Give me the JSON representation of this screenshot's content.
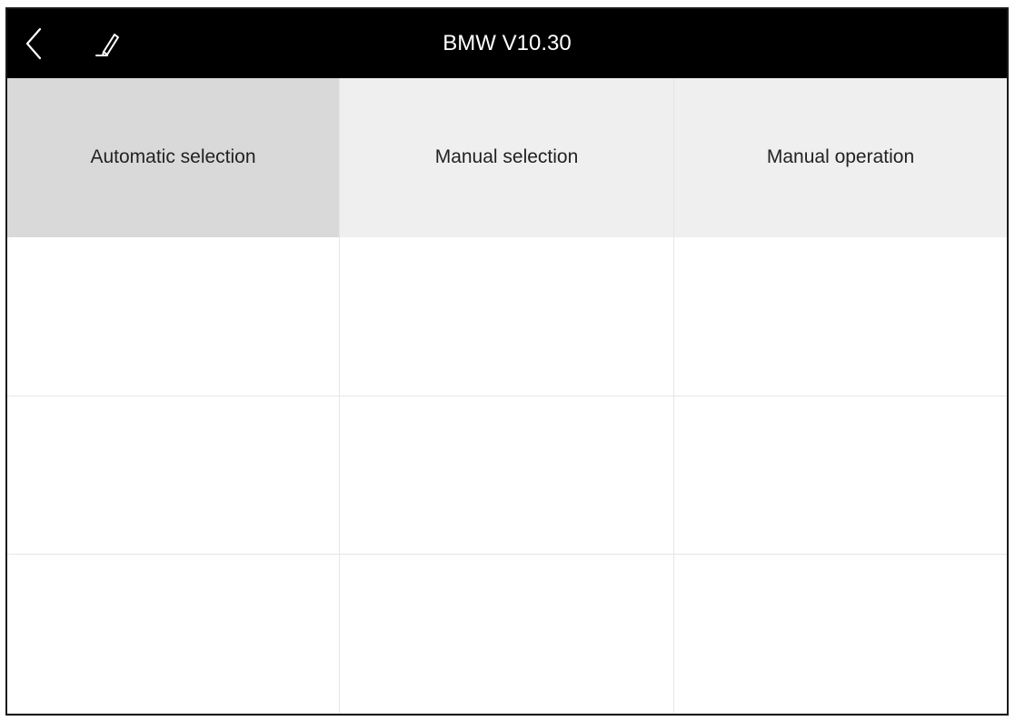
{
  "header": {
    "title": "BMW V10.30",
    "back_icon": "chevron-left-icon",
    "edit_icon": "pencil-icon"
  },
  "tabs": [
    {
      "label": "Automatic selection",
      "active": true
    },
    {
      "label": "Manual selection",
      "active": false
    },
    {
      "label": "Manual operation",
      "active": false
    }
  ],
  "colors": {
    "topbar": "#000000",
    "active_tab": "#d9d9d9",
    "inactive_tab": "#efefef",
    "divider": "#e6e6e6"
  }
}
